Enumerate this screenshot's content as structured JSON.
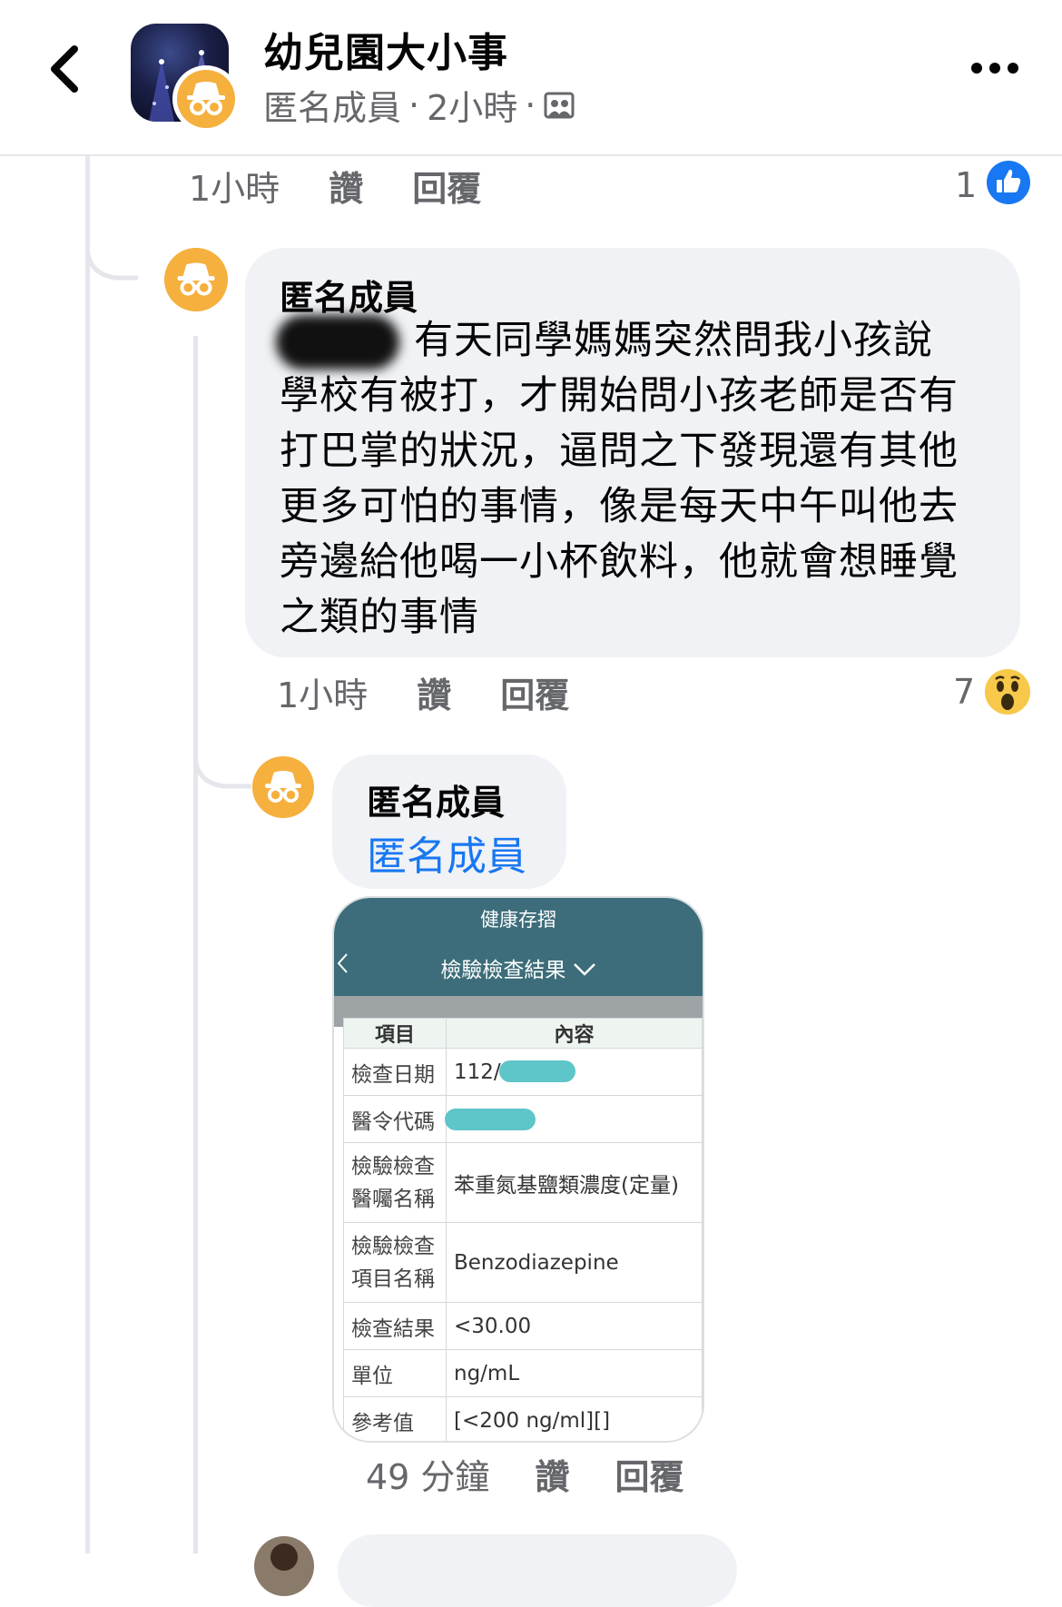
{
  "header": {
    "title": "幼兒園大小事",
    "meta_author": "匿名成員",
    "meta_time": "2小時",
    "separator": "·"
  },
  "comment_prev": {
    "time": "1小時",
    "like_label": "讚",
    "reply_label": "回覆",
    "reaction_count": "1",
    "reaction_icon": "like-icon"
  },
  "comment_main": {
    "author": "匿名成員",
    "lines": [
      "有天同學媽媽突然問我小孩說",
      "學校有被打，才開始問小孩老師是否有",
      "打巴掌的狀況，逼問之下發現還有其他",
      "更多可怕的事情，像是每天中午叫他去",
      "旁邊給他喝一小杯飲料，他就會想睡覺",
      "之類的事情"
    ],
    "time": "1小時",
    "like_label": "讚",
    "reply_label": "回覆",
    "reaction_count": "7",
    "reaction_icon": "wow-icon"
  },
  "reply": {
    "author": "匿名成員",
    "mention": "匿名成員",
    "time": "49 分鐘",
    "like_label": "讚",
    "reply_label": "回覆"
  },
  "card": {
    "app_title": "健康存摺",
    "page_title": "檢驗檢查結果",
    "header_row": [
      "項目",
      "內容"
    ],
    "rows": [
      {
        "key": "檢查日期",
        "value": "112/"
      },
      {
        "key": "醫令代碼",
        "value": ""
      },
      {
        "key": "檢驗檢查醫囑名稱",
        "value": "苯重氮基鹽類濃度(定量)"
      },
      {
        "key": "檢驗檢查項目名稱",
        "value": "Benzodiazepine"
      },
      {
        "key": "檢查結果",
        "value": "<30.00"
      },
      {
        "key": "單位",
        "value": "ng/mL"
      },
      {
        "key": "參考值",
        "value": "[<200 ng/ml][]"
      }
    ]
  },
  "colors": {
    "accent_blue": "#1877f2",
    "meta_gray": "#65676b",
    "bubble_bg": "#f0f2f5",
    "anon_orange": "#f5b03e",
    "card_header": "#3d6d7a"
  }
}
